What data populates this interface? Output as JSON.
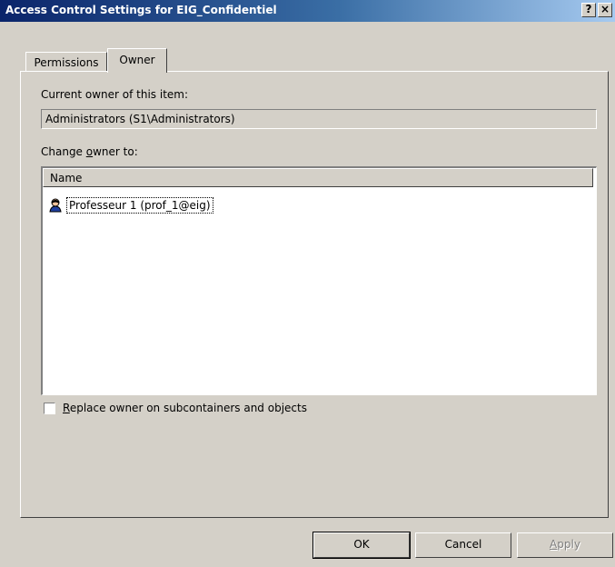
{
  "window": {
    "title": "Access Control Settings for EIG_Confidentiel",
    "help_button": "?",
    "close_button": "×"
  },
  "tabs": [
    {
      "label": "Permissions",
      "active": false
    },
    {
      "label": "Owner",
      "active": true
    }
  ],
  "owner": {
    "current_owner_label": "Current owner of this item:",
    "current_owner_value": "Administrators (S1\\Administrators)",
    "change_owner_prefix": "Change ",
    "change_owner_access": "o",
    "change_owner_suffix": "wner to:",
    "list_header": "Name",
    "list_items": [
      {
        "name": "Professeur 1 (prof_1@eig)",
        "icon": "user-icon"
      }
    ],
    "replace_access": "R",
    "replace_label_rest": "eplace owner on subcontainers and objects",
    "replace_checked": false
  },
  "buttons": {
    "ok": "OK",
    "cancel": "Cancel",
    "apply_access": "A",
    "apply_rest": "pply"
  }
}
